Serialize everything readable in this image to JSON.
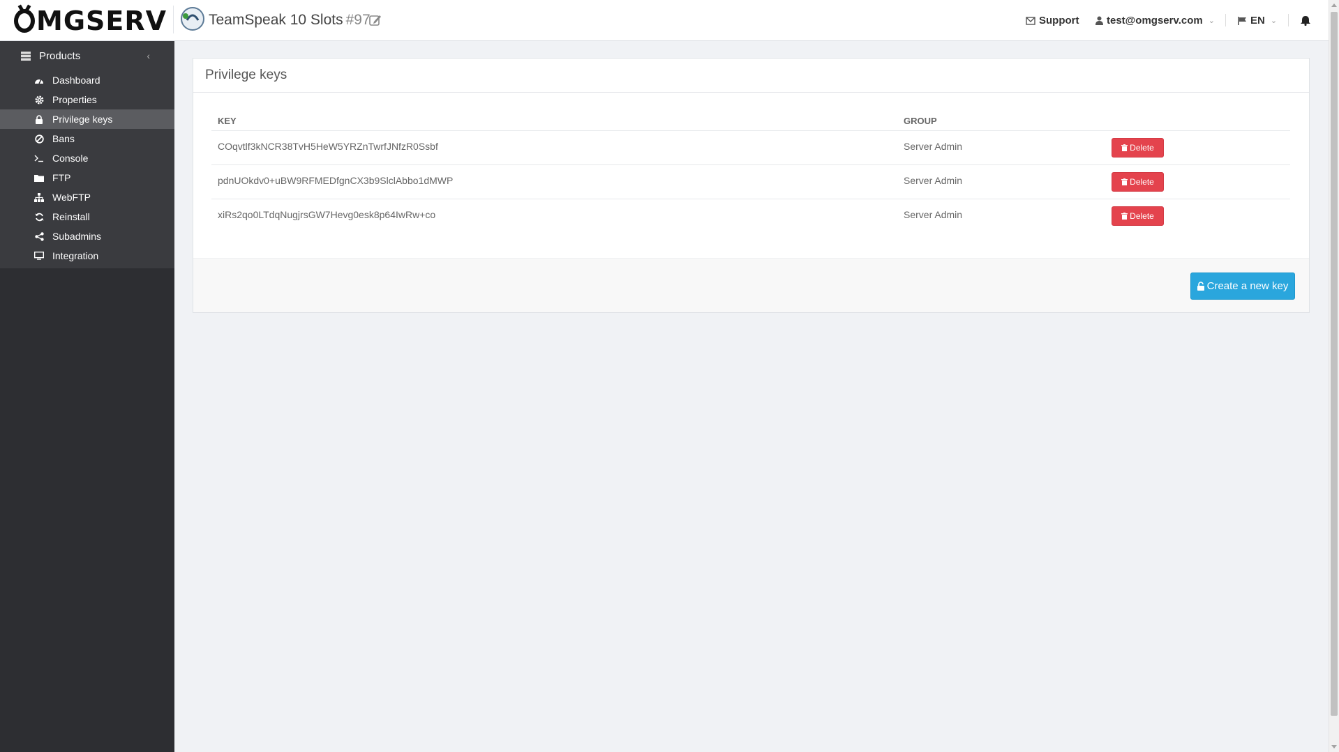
{
  "brand": {
    "logo_text": "MGSERV"
  },
  "header": {
    "product_title": "TeamSpeak 10 Slots",
    "product_number": "#97",
    "support_label": "Support",
    "user_email": "test@omgserv.com",
    "language": "EN"
  },
  "sidebar": {
    "header_label": "Products",
    "items": [
      {
        "label": "Dashboard",
        "icon": "dashboard-icon"
      },
      {
        "label": "Properties",
        "icon": "gear-icon"
      },
      {
        "label": "Privilege keys",
        "icon": "lock-icon",
        "active": true
      },
      {
        "label": "Bans",
        "icon": "ban-icon"
      },
      {
        "label": "Console",
        "icon": "terminal-icon"
      },
      {
        "label": "FTP",
        "icon": "folder-icon"
      },
      {
        "label": "WebFTP",
        "icon": "sitemap-icon"
      },
      {
        "label": "Reinstall",
        "icon": "refresh-icon"
      },
      {
        "label": "Subadmins",
        "icon": "share-icon"
      },
      {
        "label": "Integration",
        "icon": "monitor-icon"
      }
    ]
  },
  "panel": {
    "title": "Privilege keys",
    "columns": {
      "key": "KEY",
      "group": "GROUP"
    },
    "rows": [
      {
        "key": "COqvtlf3kNCR38TvH5HeW5YRZnTwrfJNfzR0Ssbf",
        "group": "Server Admin",
        "action": "Delete"
      },
      {
        "key": "pdnUOkdv0+uBW9RFMEDfgnCX3b9SlclAbbo1dMWP",
        "group": "Server Admin",
        "action": "Delete"
      },
      {
        "key": "xiRs2qo0LTdqNugjrsGW7Hevg0esk8p64IwRw+co",
        "group": "Server Admin",
        "action": "Delete"
      }
    ],
    "create_label": "Create a new key"
  },
  "colors": {
    "sidebar_bg": "#2d2e32",
    "sidebar_active": "#5b5c60",
    "delete_button": "#e4434d",
    "create_button": "#2aa6dd"
  }
}
